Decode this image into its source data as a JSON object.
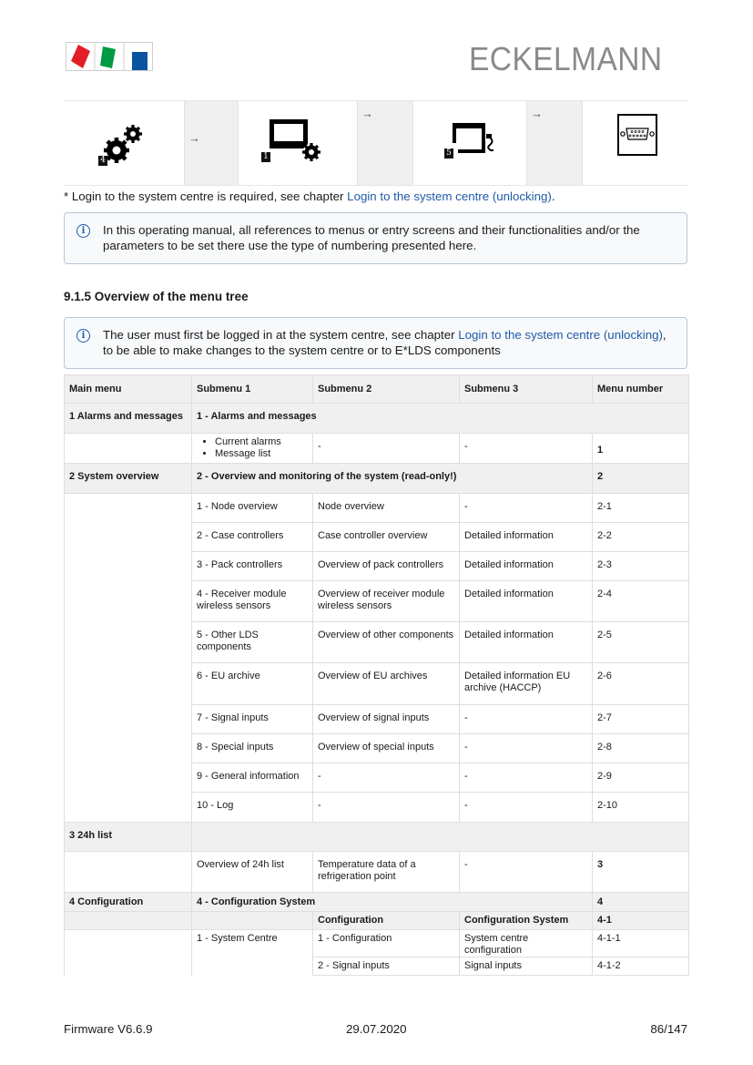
{
  "header": {
    "brand": "ECKELMANN",
    "logo_colors": [
      "#e31e24",
      "#009a44",
      "#0b52a0"
    ]
  },
  "icon_strip": {
    "items": [
      {
        "icon": "configuration-gears-icon",
        "badge": "4"
      },
      {
        "icon": "system-centre-icon",
        "badge": "1"
      },
      {
        "icon": "signal-inputs-icon",
        "badge": "5"
      },
      {
        "icon": "serial-port-icon",
        "badge": ""
      }
    ],
    "arrow": "→"
  },
  "login_note": {
    "prefix": "* Login to the system centre is required, see chapter ",
    "link": "Login to the system centre (unlocking)",
    "suffix": "."
  },
  "info_box_1": {
    "text": "In this operating manual, all references to menus or entry screens and their functionalities and/or the parameters to be set there use the type of numbering presented here."
  },
  "section": {
    "title": "9.1.5 Overview of the menu tree"
  },
  "info_box_2": {
    "prefix": "The user must first be logged in at the system centre, see chapter ",
    "link": "Login to the system centre (unlocking)",
    "suffix": ", to be able to make changes to the system centre or to E*LDS components"
  },
  "table": {
    "headers": [
      "Main menu",
      "Submenu 1",
      "Submenu 2",
      "Submenu 3",
      "Menu number"
    ],
    "alarms": {
      "main": "1 Alarms and messages",
      "group": "1 - Alarms and messages",
      "bullets": [
        "Current alarms",
        "Message list"
      ],
      "sub2": "-",
      "sub3": "-",
      "number": "1"
    },
    "overview": {
      "main": "2 System overview",
      "group": "2 - Overview and monitoring of the system (read-only!)",
      "number": "2",
      "rows": [
        {
          "sub1": "1 - Node overview",
          "sub2": "Node overview",
          "sub3": "-",
          "number": "2-1"
        },
        {
          "sub1": "2 - Case controllers",
          "sub2": "Case controller overview",
          "sub3": "Detailed information",
          "number": "2-2"
        },
        {
          "sub1": "3 - Pack controllers",
          "sub2": "Overview of pack controllers",
          "sub3": "Detailed information",
          "number": "2-3"
        },
        {
          "sub1": "4 - Receiver module wireless sensors",
          "sub2": "Overview of receiver module wireless sensors",
          "sub3": "Detailed information",
          "number": "2-4"
        },
        {
          "sub1": "5 - Other LDS components",
          "sub2": "Overview of other components",
          "sub3": "Detailed information",
          "number": "2-5"
        },
        {
          "sub1": "6 - EU archive",
          "sub2": "Overview of EU archives",
          "sub3": "Detailed information EU archive (HACCP)",
          "number": "2-6"
        },
        {
          "sub1": "7 - Signal inputs",
          "sub2": "Overview of signal inputs",
          "sub3": "-",
          "number": "2-7"
        },
        {
          "sub1": "8 - Special inputs",
          "sub2": "Overview of special inputs",
          "sub3": "-",
          "number": "2-8"
        },
        {
          "sub1": "9 - General information",
          "sub2": "-",
          "sub3": "-",
          "number": "2-9"
        },
        {
          "sub1": "10 - Log",
          "sub2": "-",
          "sub3": "-",
          "number": "2-10"
        }
      ]
    },
    "list24h": {
      "main": "3 24h list",
      "sub1": "Overview of 24h list",
      "sub2": "Temperature data of a refrigeration point",
      "sub3": "-",
      "number": "3"
    },
    "configuration": {
      "main": "4 Configuration",
      "group": "4 - Configuration System",
      "number": "4",
      "subheader": {
        "sub2": "Configuration",
        "sub3": "Configuration System",
        "number": "4-1"
      },
      "sub1": "1 - System Centre",
      "rows": [
        {
          "sub2": "1 - Configuration",
          "sub3": "System centre configuration",
          "number": "4-1-1"
        },
        {
          "sub2": "2 - Signal inputs",
          "sub3": "Signal inputs",
          "number": "4-1-2"
        }
      ]
    }
  },
  "footer": {
    "left": "Firmware V6.6.9",
    "center": "29.07.2020",
    "right": "86/147"
  }
}
